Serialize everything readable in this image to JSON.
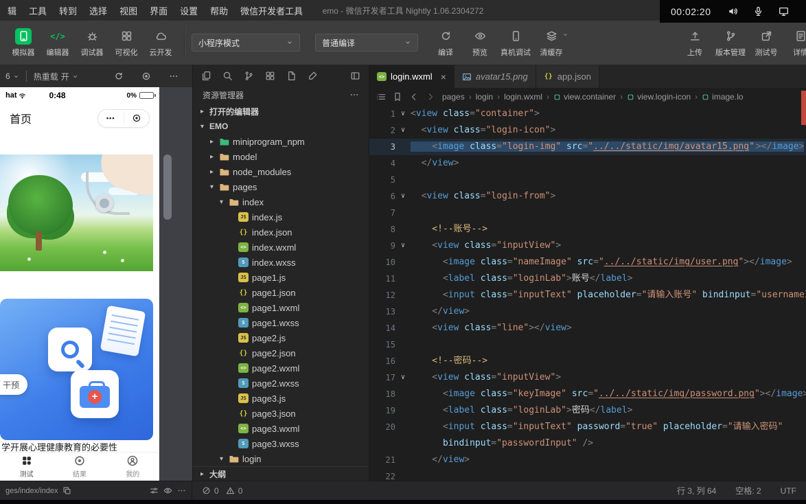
{
  "window": {
    "title": "emo - 微信开发者工具 Nightly 1.06.2304272"
  },
  "colors": {
    "wechat_green": "#07c160",
    "card_blue": "#3f7eea",
    "selection": "#264f78",
    "error_marker": "#c0493b"
  },
  "menu_bar": {
    "items": [
      "辑",
      "工具",
      "转到",
      "选择",
      "视图",
      "界面",
      "设置",
      "帮助",
      "微信开发者工具"
    ]
  },
  "recorder": {
    "time": "00:02:20",
    "icons": [
      "speaker-icon",
      "microphone-icon",
      "display-icon"
    ]
  },
  "toolbar": {
    "tools": [
      {
        "name": "simulator-button",
        "label": "模拟器",
        "icon": "simulator",
        "style": "green-bg"
      },
      {
        "name": "editor-button",
        "label": "编辑器",
        "icon": "codetext",
        "style": "green"
      },
      {
        "name": "debugger-button",
        "label": "调试器",
        "icon": "debugger"
      },
      {
        "name": "visualization-button",
        "label": "可视化",
        "icon": "visual"
      },
      {
        "name": "cloud-dev-button",
        "label": "云开发",
        "icon": "cloud"
      }
    ],
    "mode_select": "小程序模式",
    "compile_select": "普通编译",
    "actions": [
      {
        "name": "compile-button",
        "label": "编译",
        "icon": "compile"
      },
      {
        "name": "preview-button",
        "label": "预览",
        "icon": "preview"
      },
      {
        "name": "real-device-debug-button",
        "label": "真机调试",
        "icon": "realdevice"
      },
      {
        "name": "clear-cache-button",
        "label": "清缓存",
        "icon": "clearcache",
        "dropdown": true
      }
    ],
    "right_actions": [
      {
        "name": "upload-button",
        "label": "上传",
        "icon": "upload"
      },
      {
        "name": "version-control-button",
        "label": "版本管理",
        "icon": "version"
      },
      {
        "name": "test-account-button",
        "label": "测试号",
        "icon": "testaccount"
      },
      {
        "name": "details-button",
        "label": "详情",
        "icon": "details"
      }
    ]
  },
  "simulator": {
    "device_label": "6",
    "hot_reload_label": "热重载",
    "hot_reload_value": "开",
    "bottom_path": "ges/index/index",
    "phone": {
      "carrier": "hat",
      "status_time": "0:48",
      "battery_percent": "0%",
      "nav_title": "首页",
      "capsule_dots": "•••",
      "bubble_label": "干预",
      "headline": "学开展心理健康教育的必要性",
      "tabs": [
        {
          "name": "phone-tab-test",
          "label": "测试",
          "icon": "testgrid",
          "active": true
        },
        {
          "name": "phone-tab-result",
          "label": "结果",
          "icon": "target"
        },
        {
          "name": "phone-tab-mine",
          "label": "我的",
          "icon": "person"
        }
      ]
    }
  },
  "explorer": {
    "header_icons": [
      "files",
      "search",
      "version",
      "grid",
      "file",
      "brush"
    ],
    "title": "资源管理器",
    "tree": [
      {
        "kind": "section",
        "chevron": "right",
        "label": "打开的编辑器",
        "depth": 0
      },
      {
        "kind": "section",
        "chevron": "down",
        "label": "EMO",
        "depth": 0
      },
      {
        "kind": "folder",
        "chevron": "right",
        "label": "miniprogram_npm",
        "depth": 1,
        "color": "#3db87a"
      },
      {
        "kind": "folder",
        "chevron": "right",
        "label": "model",
        "depth": 1,
        "color": "#dcb67a"
      },
      {
        "kind": "folder",
        "chevron": "right",
        "label": "node_modules",
        "depth": 1,
        "color": "#dcb67a"
      },
      {
        "kind": "folder",
        "chevron": "down",
        "label": "pages",
        "depth": 1,
        "color": "#dcb67a"
      },
      {
        "kind": "folder",
        "chevron": "down",
        "label": "index",
        "depth": 2,
        "color": "#dcb67a"
      },
      {
        "kind": "file",
        "filetype": "js",
        "label": "index.js",
        "depth": 3
      },
      {
        "kind": "file",
        "filetype": "json",
        "label": "index.json",
        "depth": 3
      },
      {
        "kind": "file",
        "filetype": "wxml",
        "label": "index.wxml",
        "depth": 3
      },
      {
        "kind": "file",
        "filetype": "wxss",
        "label": "index.wxss",
        "depth": 3
      },
      {
        "kind": "file",
        "filetype": "js",
        "label": "page1.js",
        "depth": 3
      },
      {
        "kind": "file",
        "filetype": "json",
        "label": "page1.json",
        "depth": 3
      },
      {
        "kind": "file",
        "filetype": "wxml",
        "label": "page1.wxml",
        "depth": 3
      },
      {
        "kind": "file",
        "filetype": "wxss",
        "label": "page1.wxss",
        "depth": 3
      },
      {
        "kind": "file",
        "filetype": "js",
        "label": "page2.js",
        "depth": 3
      },
      {
        "kind": "file",
        "filetype": "json",
        "label": "page2.json",
        "depth": 3
      },
      {
        "kind": "file",
        "filetype": "wxml",
        "label": "page2.wxml",
        "depth": 3
      },
      {
        "kind": "file",
        "filetype": "wxss",
        "label": "page2.wxss",
        "depth": 3
      },
      {
        "kind": "file",
        "filetype": "js",
        "label": "page3.js",
        "depth": 3
      },
      {
        "kind": "file",
        "filetype": "json",
        "label": "page3.json",
        "depth": 3
      },
      {
        "kind": "file",
        "filetype": "wxml",
        "label": "page3.wxml",
        "depth": 3
      },
      {
        "kind": "file",
        "filetype": "wxss",
        "label": "page3.wxss",
        "depth": 3
      },
      {
        "kind": "folder",
        "chevron": "down",
        "label": "login",
        "depth": 2,
        "color": "#dcb67a"
      },
      {
        "kind": "section",
        "chevron": "right",
        "label": "大纲",
        "depth": 0,
        "divider": true
      }
    ]
  },
  "editor": {
    "tabs": [
      {
        "name": "tab-login-wxml",
        "label": "login.wxml",
        "icon": "wxml",
        "active": true,
        "close": "×"
      },
      {
        "name": "tab-avatar15-png",
        "label": "avatar15.png",
        "icon": "image",
        "preview": true
      },
      {
        "name": "tab-app-json",
        "label": "app.json",
        "icon": "json"
      }
    ],
    "breadcrumbs": [
      {
        "label": "pages"
      },
      {
        "label": "login"
      },
      {
        "label": "login.wxml"
      },
      {
        "label": "view.container",
        "symbol": true
      },
      {
        "label": "view.login-icon",
        "symbol": true
      },
      {
        "label": "image.lo",
        "symbol": true
      }
    ],
    "lines": [
      {
        "n": "1",
        "fold": true,
        "tokens": [
          [
            "p",
            "<"
          ],
          [
            "t",
            "view"
          ],
          [
            "a",
            " class"
          ],
          [
            "p",
            "="
          ],
          [
            "s",
            "\"container\""
          ],
          [
            "p",
            ">"
          ]
        ]
      },
      {
        "n": "2",
        "fold": true,
        "tokens": [
          [
            "p",
            "  <"
          ],
          [
            "t",
            "view"
          ],
          [
            "a",
            " class"
          ],
          [
            "p",
            "="
          ],
          [
            "s",
            "\"login-icon\""
          ],
          [
            "p",
            ">"
          ]
        ]
      },
      {
        "n": "3",
        "sel": true,
        "tokens": [
          [
            "p",
            "    <"
          ],
          [
            "t",
            "image"
          ],
          [
            "a",
            " class"
          ],
          [
            "p",
            "="
          ],
          [
            "s",
            "\"login-img\""
          ],
          [
            "a",
            " src"
          ],
          [
            "p",
            "="
          ],
          [
            "s",
            "\""
          ],
          [
            "l",
            "../../static/img/avatar15.png"
          ],
          [
            "s",
            "\""
          ],
          [
            "k",
            ""
          ],
          [
            "p",
            "></"
          ],
          [
            "t",
            "image"
          ],
          [
            "p",
            ">"
          ]
        ]
      },
      {
        "n": "4",
        "tokens": [
          [
            "p",
            "  </"
          ],
          [
            "t",
            "view"
          ],
          [
            "p",
            ">"
          ]
        ]
      },
      {
        "n": "5",
        "tokens": []
      },
      {
        "n": "6",
        "fold": true,
        "tokens": [
          [
            "p",
            "  <"
          ],
          [
            "t",
            "view"
          ],
          [
            "a",
            " class"
          ],
          [
            "p",
            "="
          ],
          [
            "s",
            "\"login-from\""
          ],
          [
            "p",
            ">"
          ]
        ]
      },
      {
        "n": "7",
        "tokens": []
      },
      {
        "n": "8",
        "tokens": [
          [
            "c",
            "    <!--账号-->"
          ]
        ]
      },
      {
        "n": "9",
        "fold": true,
        "tokens": [
          [
            "p",
            "    <"
          ],
          [
            "t",
            "view"
          ],
          [
            "a",
            " class"
          ],
          [
            "p",
            "="
          ],
          [
            "s",
            "\"inputView\""
          ],
          [
            "p",
            ">"
          ]
        ]
      },
      {
        "n": "10",
        "tokens": [
          [
            "p",
            "      <"
          ],
          [
            "t",
            "image"
          ],
          [
            "a",
            " class"
          ],
          [
            "p",
            "="
          ],
          [
            "s",
            "\"nameImage\""
          ],
          [
            "a",
            " src"
          ],
          [
            "p",
            "="
          ],
          [
            "s",
            "\""
          ],
          [
            "l",
            "../../static/img/user.png"
          ],
          [
            "s",
            "\""
          ],
          [
            "p",
            "></"
          ],
          [
            "t",
            "image"
          ],
          [
            "p",
            ">"
          ]
        ]
      },
      {
        "n": "11",
        "tokens": [
          [
            "p",
            "      <"
          ],
          [
            "t",
            "label"
          ],
          [
            "a",
            " class"
          ],
          [
            "p",
            "="
          ],
          [
            "s",
            "\"loginLab\""
          ],
          [
            "p",
            ">"
          ],
          [
            "x",
            "账号"
          ],
          [
            "p",
            "</"
          ],
          [
            "t",
            "label"
          ],
          [
            "p",
            ">"
          ]
        ]
      },
      {
        "n": "12",
        "tokens": [
          [
            "p",
            "      <"
          ],
          [
            "t",
            "input"
          ],
          [
            "a",
            " class"
          ],
          [
            "p",
            "="
          ],
          [
            "s",
            "\"inputText\""
          ],
          [
            "a",
            " placeholder"
          ],
          [
            "p",
            "="
          ],
          [
            "s",
            "\"请输入账号\""
          ],
          [
            "a",
            " bindinput"
          ],
          [
            "p",
            "="
          ],
          [
            "s",
            "\"usernameInput\""
          ],
          [
            "p",
            " />"
          ]
        ]
      },
      {
        "n": "13",
        "tokens": [
          [
            "p",
            "    </"
          ],
          [
            "t",
            "view"
          ],
          [
            "p",
            ">"
          ]
        ]
      },
      {
        "n": "14",
        "tokens": [
          [
            "p",
            "    <"
          ],
          [
            "t",
            "view"
          ],
          [
            "a",
            " class"
          ],
          [
            "p",
            "="
          ],
          [
            "s",
            "\"line\""
          ],
          [
            "p",
            "></"
          ],
          [
            "t",
            "view"
          ],
          [
            "p",
            ">"
          ]
        ]
      },
      {
        "n": "15",
        "tokens": []
      },
      {
        "n": "16",
        "tokens": [
          [
            "c",
            "    <!--密码-->"
          ]
        ]
      },
      {
        "n": "17",
        "fold": true,
        "tokens": [
          [
            "p",
            "    <"
          ],
          [
            "t",
            "view"
          ],
          [
            "a",
            " class"
          ],
          [
            "p",
            "="
          ],
          [
            "s",
            "\"inputView\""
          ],
          [
            "p",
            ">"
          ]
        ]
      },
      {
        "n": "18",
        "tokens": [
          [
            "p",
            "      <"
          ],
          [
            "t",
            "image"
          ],
          [
            "a",
            " class"
          ],
          [
            "p",
            "="
          ],
          [
            "s",
            "\"keyImage\""
          ],
          [
            "a",
            " src"
          ],
          [
            "p",
            "="
          ],
          [
            "s",
            "\""
          ],
          [
            "l",
            "../../static/img/password.png"
          ],
          [
            "s",
            "\""
          ],
          [
            "p",
            "></"
          ],
          [
            "t",
            "image"
          ],
          [
            "p",
            ">"
          ]
        ]
      },
      {
        "n": "19",
        "tokens": [
          [
            "p",
            "      <"
          ],
          [
            "t",
            "label"
          ],
          [
            "a",
            " class"
          ],
          [
            "p",
            "="
          ],
          [
            "s",
            "\"loginLab\""
          ],
          [
            "p",
            ">"
          ],
          [
            "x",
            "密码"
          ],
          [
            "p",
            "</"
          ],
          [
            "t",
            "label"
          ],
          [
            "p",
            ">"
          ]
        ]
      },
      {
        "n": "20",
        "tokens": [
          [
            "p",
            "      <"
          ],
          [
            "t",
            "input"
          ],
          [
            "a",
            " class"
          ],
          [
            "p",
            "="
          ],
          [
            "s",
            "\"inputText\""
          ],
          [
            "a",
            " password"
          ],
          [
            "p",
            "="
          ],
          [
            "s",
            "\"true\""
          ],
          [
            "a",
            " placeholder"
          ],
          [
            "p",
            "="
          ],
          [
            "s",
            "\"请输入密码\""
          ]
        ]
      },
      {
        "n": "",
        "tokens": [
          [
            "a",
            "      bindinput"
          ],
          [
            "p",
            "="
          ],
          [
            "s",
            "\"passwordInput\""
          ],
          [
            "p",
            " />"
          ]
        ]
      },
      {
        "n": "21",
        "tokens": [
          [
            "p",
            "    </"
          ],
          [
            "t",
            "view"
          ],
          [
            "p",
            ">"
          ]
        ]
      },
      {
        "n": "22",
        "tokens": []
      }
    ]
  },
  "status_bar": {
    "errors": "0",
    "warnings": "0",
    "cursor_position": "行 3, 列 64",
    "indentation": "空格: 2",
    "encoding": "UTF"
  }
}
